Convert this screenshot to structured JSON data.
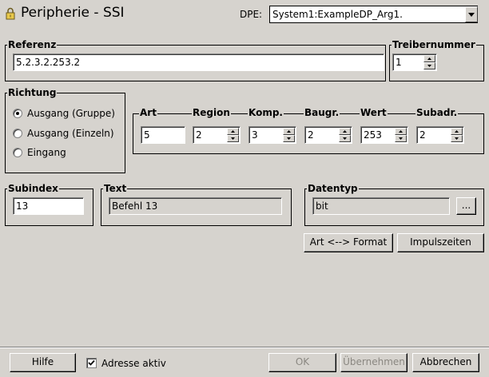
{
  "header": {
    "title": "Peripherie - SSI",
    "dpe_label": "DPE:",
    "dpe_value": "System1:ExampleDP_Arg1."
  },
  "referenz": {
    "label": "Referenz",
    "value": "5.2.3.2.253.2"
  },
  "treibernummer": {
    "label": "Treibernummer",
    "value": "1"
  },
  "richtung": {
    "label": "Richtung",
    "options": [
      "Ausgang (Gruppe)",
      "Ausgang (Einzeln)",
      "Eingang"
    ],
    "selected": "Ausgang (Gruppe)"
  },
  "address": {
    "fields": [
      {
        "label": "Art",
        "value": "5"
      },
      {
        "label": "Region",
        "value": "2"
      },
      {
        "label": "Komp.",
        "value": "3"
      },
      {
        "label": "Baugr.",
        "value": "2"
      },
      {
        "label": "Wert",
        "value": "253"
      },
      {
        "label": "Subadr.",
        "value": "2"
      }
    ]
  },
  "subindex": {
    "label": "Subindex",
    "value": "13"
  },
  "text": {
    "label": "Text",
    "value": "Befehl 13"
  },
  "datentyp": {
    "label": "Datentyp",
    "value": "bit",
    "browse_label": "..."
  },
  "actions": {
    "art_format": "Art <--> Format",
    "impulszeiten": "Impulszeiten"
  },
  "footer": {
    "hilfe": "Hilfe",
    "adresse_aktiv": "Adresse aktiv",
    "adresse_aktiv_checked": true,
    "ok": "OK",
    "uebernehmen": "Übernehmen",
    "abbrechen": "Abbrechen"
  }
}
